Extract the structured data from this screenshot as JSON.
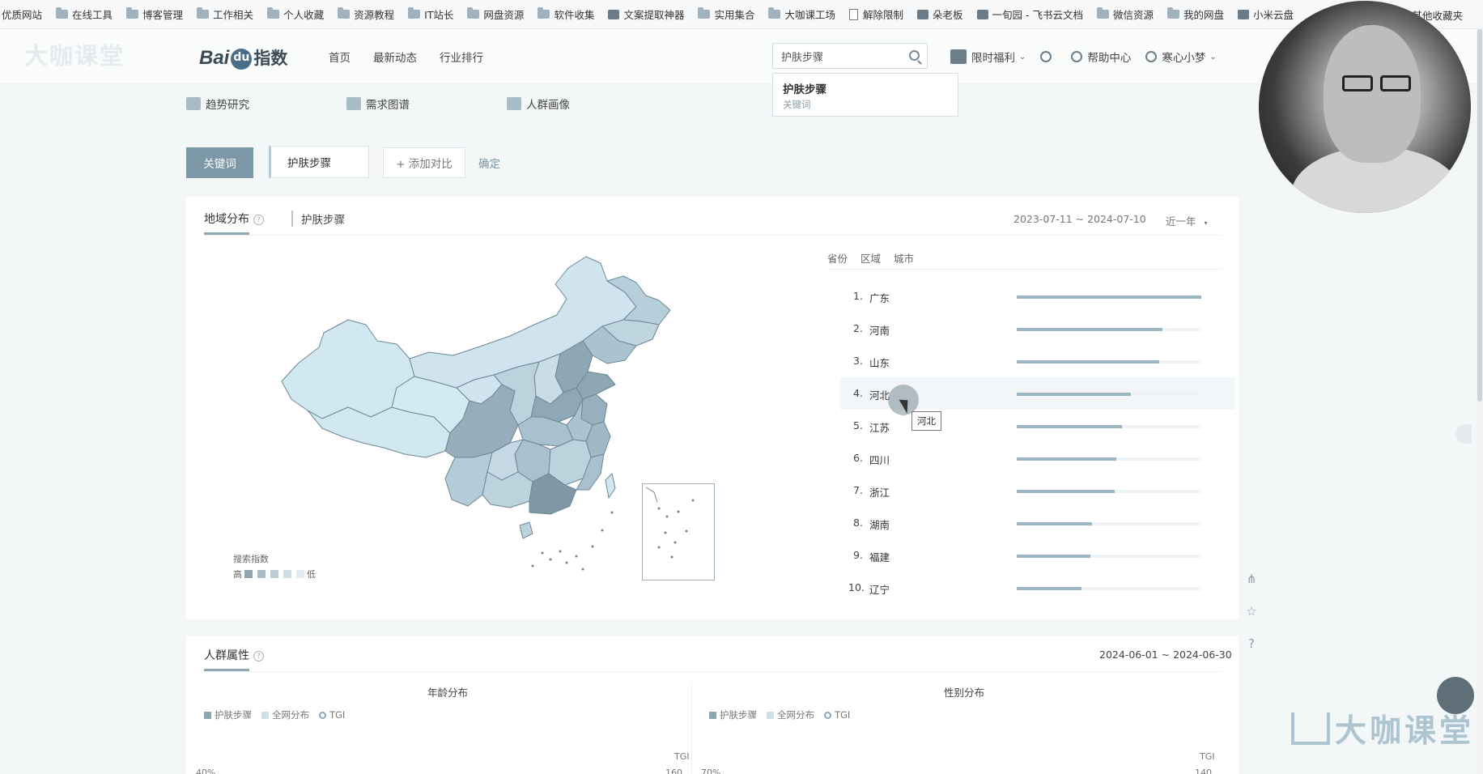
{
  "bookmarks": [
    {
      "label": "优质网站",
      "icon": "folder-icon"
    },
    {
      "label": "在线工具",
      "icon": "folder-icon"
    },
    {
      "label": "博客管理",
      "icon": "folder-icon"
    },
    {
      "label": "工作相关",
      "icon": "folder-icon"
    },
    {
      "label": "个人收藏",
      "icon": "folder-icon"
    },
    {
      "label": "资源教程",
      "icon": "folder-icon"
    },
    {
      "label": "IT站长",
      "icon": "folder-icon"
    },
    {
      "label": "网盘资源",
      "icon": "folder-icon"
    },
    {
      "label": "软件收集",
      "icon": "folder-icon"
    },
    {
      "label": "文案提取神器",
      "icon": "picture-icon"
    },
    {
      "label": "实用集合",
      "icon": "folder-icon"
    },
    {
      "label": "大咖课工场",
      "icon": "folder-icon"
    },
    {
      "label": "解除限制",
      "icon": "document-icon"
    },
    {
      "label": "朵老板",
      "icon": "picture-icon"
    },
    {
      "label": "一旬园 - 飞书云文档",
      "icon": "picture-icon"
    },
    {
      "label": "微信资源",
      "icon": "folder-icon"
    },
    {
      "label": "我的网盘",
      "icon": "folder-icon"
    },
    {
      "label": "小米云盘",
      "icon": "picture-icon"
    }
  ],
  "bookmarks_overflow": "其他收藏夹",
  "watermark_top": "大咖课堂",
  "logo": {
    "bai": "Bai",
    "zhi": "指数"
  },
  "nav": [
    "首页",
    "最新动态",
    "行业排行"
  ],
  "search": {
    "value": "护肤步骤"
  },
  "suggestion": {
    "title": "护肤步骤",
    "type": "关键词"
  },
  "top_right": {
    "welfare": "限时福利",
    "help": "帮助中心",
    "user": "寒心小梦"
  },
  "subtabs": [
    "趋势研究",
    "需求图谱",
    "人群画像"
  ],
  "keyword_row": {
    "keyword_btn": "关键词",
    "keyword": "护肤步骤",
    "add_compare": "+ 添加对比",
    "confirm": "确定"
  },
  "region": {
    "title": "地域分布",
    "keyword": "护肤步骤",
    "date_range": "2023-07-11 ~ 2024-07-10",
    "period": "近一年",
    "tabs": [
      "省份",
      "区域",
      "城市"
    ],
    "legend_title": "搜索指数",
    "legend_high": "高",
    "legend_low": "低",
    "legend_colors": [
      "#8fa7b3",
      "#a7bcc7",
      "#bccdd6",
      "#d0dee5",
      "#e2ecf0"
    ],
    "tooltip": "河北",
    "rankings": [
      {
        "rank": "1.",
        "name": "广东",
        "value": 100
      },
      {
        "rank": "2.",
        "name": "河南",
        "value": 79
      },
      {
        "rank": "3.",
        "name": "山东",
        "value": 77
      },
      {
        "rank": "4.",
        "name": "河北",
        "value": 62
      },
      {
        "rank": "5.",
        "name": "江苏",
        "value": 57
      },
      {
        "rank": "6.",
        "name": "四川",
        "value": 54
      },
      {
        "rank": "7.",
        "name": "浙江",
        "value": 53
      },
      {
        "rank": "8.",
        "name": "湖南",
        "value": 41
      },
      {
        "rank": "9.",
        "name": "福建",
        "value": 40
      },
      {
        "rank": "10.",
        "name": "辽宁",
        "value": 35
      }
    ]
  },
  "people": {
    "title": "人群属性",
    "date_range": "2024-06-01 ~ 2024-06-30",
    "age": {
      "title": "年龄分布",
      "legend": [
        "护肤步骤",
        "全网分布",
        "TGI"
      ],
      "tgi_label": "TGI",
      "y_left": "40%",
      "y_right": "160"
    },
    "gender": {
      "title": "性别分布",
      "legend": [
        "护肤步骤",
        "全网分布",
        "TGI"
      ],
      "tgi_label": "TGI",
      "y_left": "70%",
      "y_right": "140"
    }
  },
  "watermark_bottom": "大咖课堂"
}
